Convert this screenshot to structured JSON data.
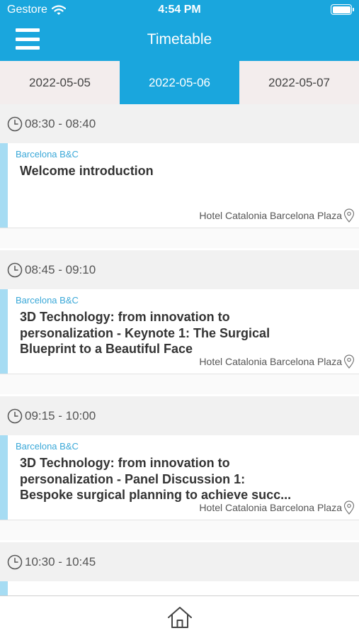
{
  "status_bar": {
    "carrier": "Gestore",
    "time": "4:54 PM",
    "wifi_icon": "wifi-icon",
    "battery_icon": "battery-icon"
  },
  "header": {
    "title": "Timetable",
    "menu_icon": "hamburger-menu-icon"
  },
  "tabs": [
    {
      "label": "2022-05-05",
      "active": false
    },
    {
      "label": "2022-05-06",
      "active": true
    },
    {
      "label": "2022-05-07",
      "active": false
    }
  ],
  "sessions": [
    {
      "time": "08:30 - 08:40",
      "org": "Barcelona B&C",
      "title_lines": [
        "Welcome introduction"
      ],
      "location": "Hotel Catalonia Barcelona Plaza"
    },
    {
      "time": "08:45 - 09:10",
      "org": "Barcelona B&C",
      "title_lines": [
        "3D Technology: from innovation to",
        "personalization - Keynote 1: The Surgical",
        "Blueprint to a Beautiful Face"
      ],
      "location": "Hotel Catalonia Barcelona Plaza"
    },
    {
      "time": "09:15 - 10:00",
      "org": "Barcelona B&C",
      "title_lines": [
        "3D Technology: from innovation to",
        "personalization - Panel Discussion 1:",
        "Bespoke surgical planning to achieve succ..."
      ],
      "location": "Hotel Catalonia Barcelona Plaza"
    },
    {
      "time": "10:30 - 10:45"
    }
  ],
  "colors": {
    "primary": "#1aa6dd",
    "card_bar": "#a6dcf3",
    "org_text": "#3aa8d8"
  },
  "footer": {
    "home_icon": "home-icon"
  }
}
